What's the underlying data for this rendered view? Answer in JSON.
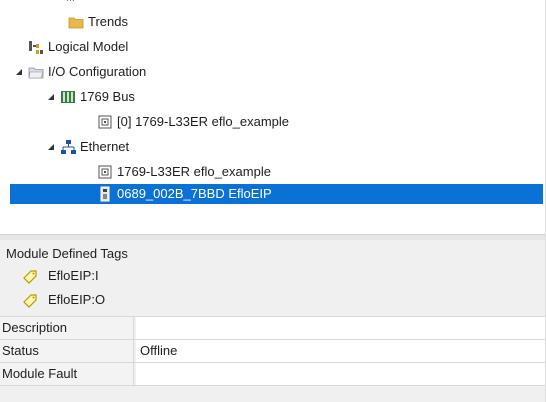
{
  "tree": {
    "items": [
      {
        "label": "Trends",
        "icon": "folder-icon"
      },
      {
        "label": "Logical Model",
        "icon": "logical-model-icon"
      },
      {
        "label": "I/O Configuration",
        "icon": "io-folder-icon"
      },
      {
        "label": "1769 Bus",
        "icon": "backplane-icon"
      },
      {
        "label": "[0] 1769-L33ER eflo_example",
        "icon": "controller-module-icon"
      },
      {
        "label": "Ethernet",
        "icon": "ethernet-network-icon"
      },
      {
        "label": "1769-L33ER eflo_example",
        "icon": "controller-module-icon"
      },
      {
        "label": "0689_002B_7BBD EfloEIP",
        "icon": "device-module-icon"
      }
    ],
    "selected_index": 7
  },
  "properties": {
    "section_title": "Module Defined Tags",
    "tags": [
      "EfloEIP:I",
      "EfloEIP:O"
    ],
    "rows": [
      {
        "key": "Description",
        "value": ""
      },
      {
        "key": "Status",
        "value": "Offline"
      },
      {
        "key": "Module Fault",
        "value": ""
      }
    ]
  },
  "colors": {
    "selection": "#0a72d6",
    "folder": "#e8b84a",
    "tag_outline": "#b59a00"
  }
}
